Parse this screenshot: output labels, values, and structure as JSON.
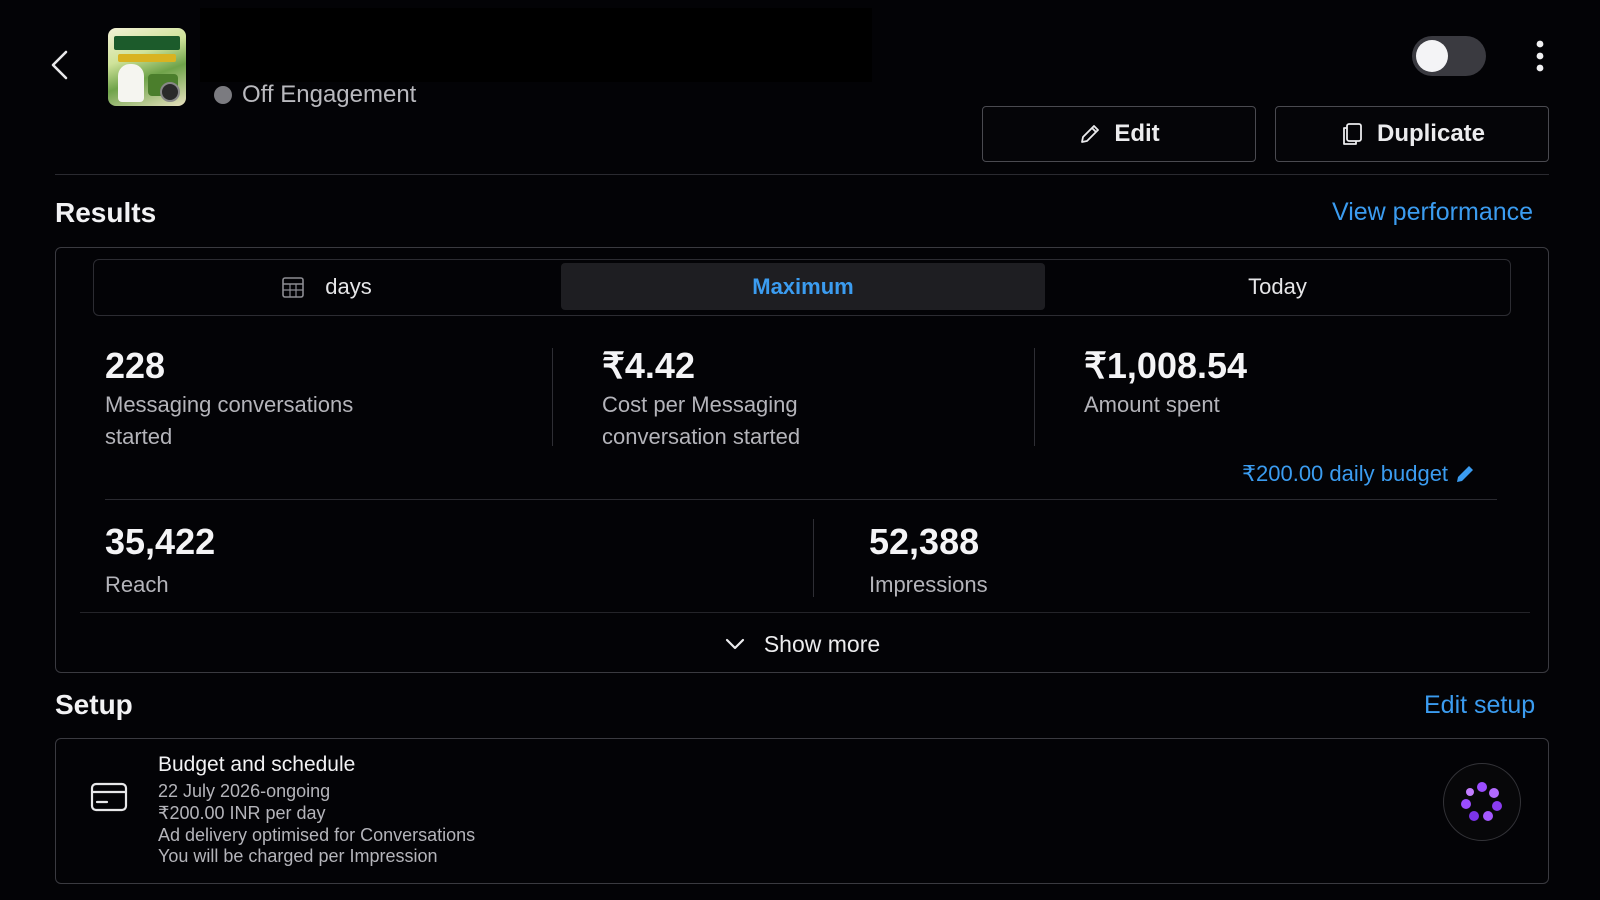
{
  "header": {
    "campaign_status": "Off Engagement",
    "toggle_on": false,
    "edit_label": "Edit",
    "duplicate_label": "Duplicate"
  },
  "results": {
    "title": "Results",
    "view_performance": "View performance",
    "tabs": [
      {
        "label": "days",
        "active": false
      },
      {
        "label": "Maximum",
        "active": true
      },
      {
        "label": "Today",
        "active": false
      }
    ],
    "metrics_row1": [
      {
        "value": "228",
        "label_line1": "Messaging conversations",
        "label_line2": "started"
      },
      {
        "value": "₹4.42",
        "label_line1": "Cost per Messaging",
        "label_line2": "conversation started"
      },
      {
        "value": "₹1,008.54",
        "label_line1": "Amount spent",
        "label_line2": ""
      }
    ],
    "daily_budget": "₹200.00 daily budget",
    "metrics_row2": [
      {
        "value": "35,422",
        "label": "Reach"
      },
      {
        "value": "52,388",
        "label": "Impressions"
      }
    ],
    "show_more": "Show more"
  },
  "setup": {
    "title": "Setup",
    "edit_setup": "Edit setup",
    "budget_schedule": {
      "heading": "Budget and schedule",
      "lines": [
        "22 July 2026-ongoing",
        "₹200.00 INR per day",
        "Ad delivery optimised for Conversations",
        "You will be charged per Impression"
      ]
    }
  },
  "colors": {
    "accent": "#3b9cf0",
    "background": "#030306",
    "ai_purple": "#9b4dff"
  },
  "icons": [
    "back-chevron-icon",
    "more-vertical-icon",
    "pencil-icon",
    "copy-icon",
    "calendar-icon",
    "chevron-down-icon",
    "credit-card-icon",
    "meta-ai-icon"
  ]
}
